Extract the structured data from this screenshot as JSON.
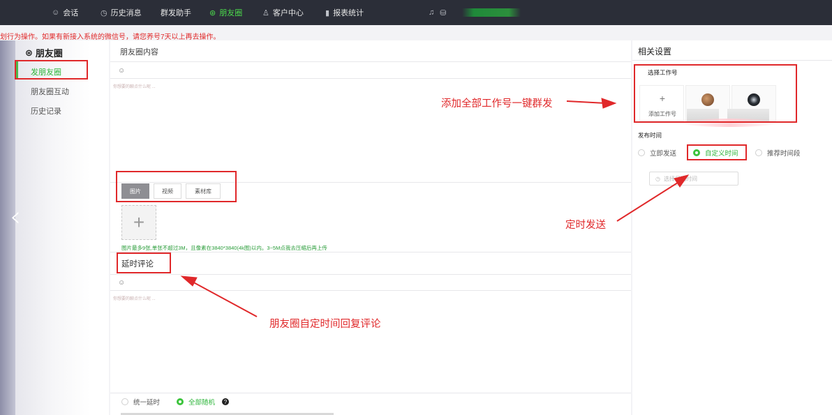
{
  "topbar": {
    "nav": [
      {
        "label": "会话",
        "icon": "chat-icon",
        "active": false
      },
      {
        "label": "历史消息",
        "icon": "clock-icon",
        "active": false
      },
      {
        "label": "群发助手",
        "icon": "",
        "active": false
      },
      {
        "label": "朋友圈",
        "icon": "moments-icon",
        "active": true
      },
      {
        "label": "客户中心",
        "icon": "user-icon",
        "active": false
      },
      {
        "label": "报表统计",
        "icon": "bar-chart-icon",
        "active": false
      }
    ]
  },
  "notice": "划行为操作。如果有新接入系统的微信号，请您养号7天以上再去操作。",
  "sidebar": {
    "title": "朋友圈",
    "items": [
      {
        "label": "发朋友圈",
        "active": true
      },
      {
        "label": "朋友圈互动",
        "active": false
      },
      {
        "label": "历史记录",
        "active": false
      }
    ]
  },
  "main": {
    "content_label": "朋友圈内容",
    "placeholder": "你想要的聊点什么呢 ...",
    "media_tabs": [
      {
        "label": "图片",
        "active": true
      },
      {
        "label": "视频",
        "active": false
      },
      {
        "label": "素材库",
        "active": false
      }
    ],
    "upload_plus": "+",
    "hint": "图片最多9张,单张不超过3M，且像素在3840*3840(4k图)以内。3~5M点我去压缩后再上传",
    "comment_label": "延时评论",
    "comment_placeholder": "你想要的聊点什么呢 ...",
    "delay_options": [
      {
        "label": "统一延时",
        "selected": false
      },
      {
        "label": "全部随机",
        "selected": true
      }
    ],
    "help": "?"
  },
  "settings": {
    "title": "相关设置",
    "select_worker_label": "选择工作号",
    "add_worker_label": "添加工作号",
    "add_plus": "+",
    "publish_time_label": "发布时间",
    "time_options": [
      {
        "label": "立即发送",
        "selected": false
      },
      {
        "label": "自定义时间",
        "selected": true
      },
      {
        "label": "推荐时间段",
        "selected": false
      }
    ],
    "time_placeholder": "选择日期时间"
  },
  "annotations": {
    "broadcast": "添加全部工作号一键群发",
    "scheduled": "定时发送",
    "comment": "朋友圈自定时间回复评论"
  },
  "colors": {
    "accent_green": "#2db53a",
    "annotation_red": "#e0282a",
    "topbar_bg": "#2b2e38"
  }
}
